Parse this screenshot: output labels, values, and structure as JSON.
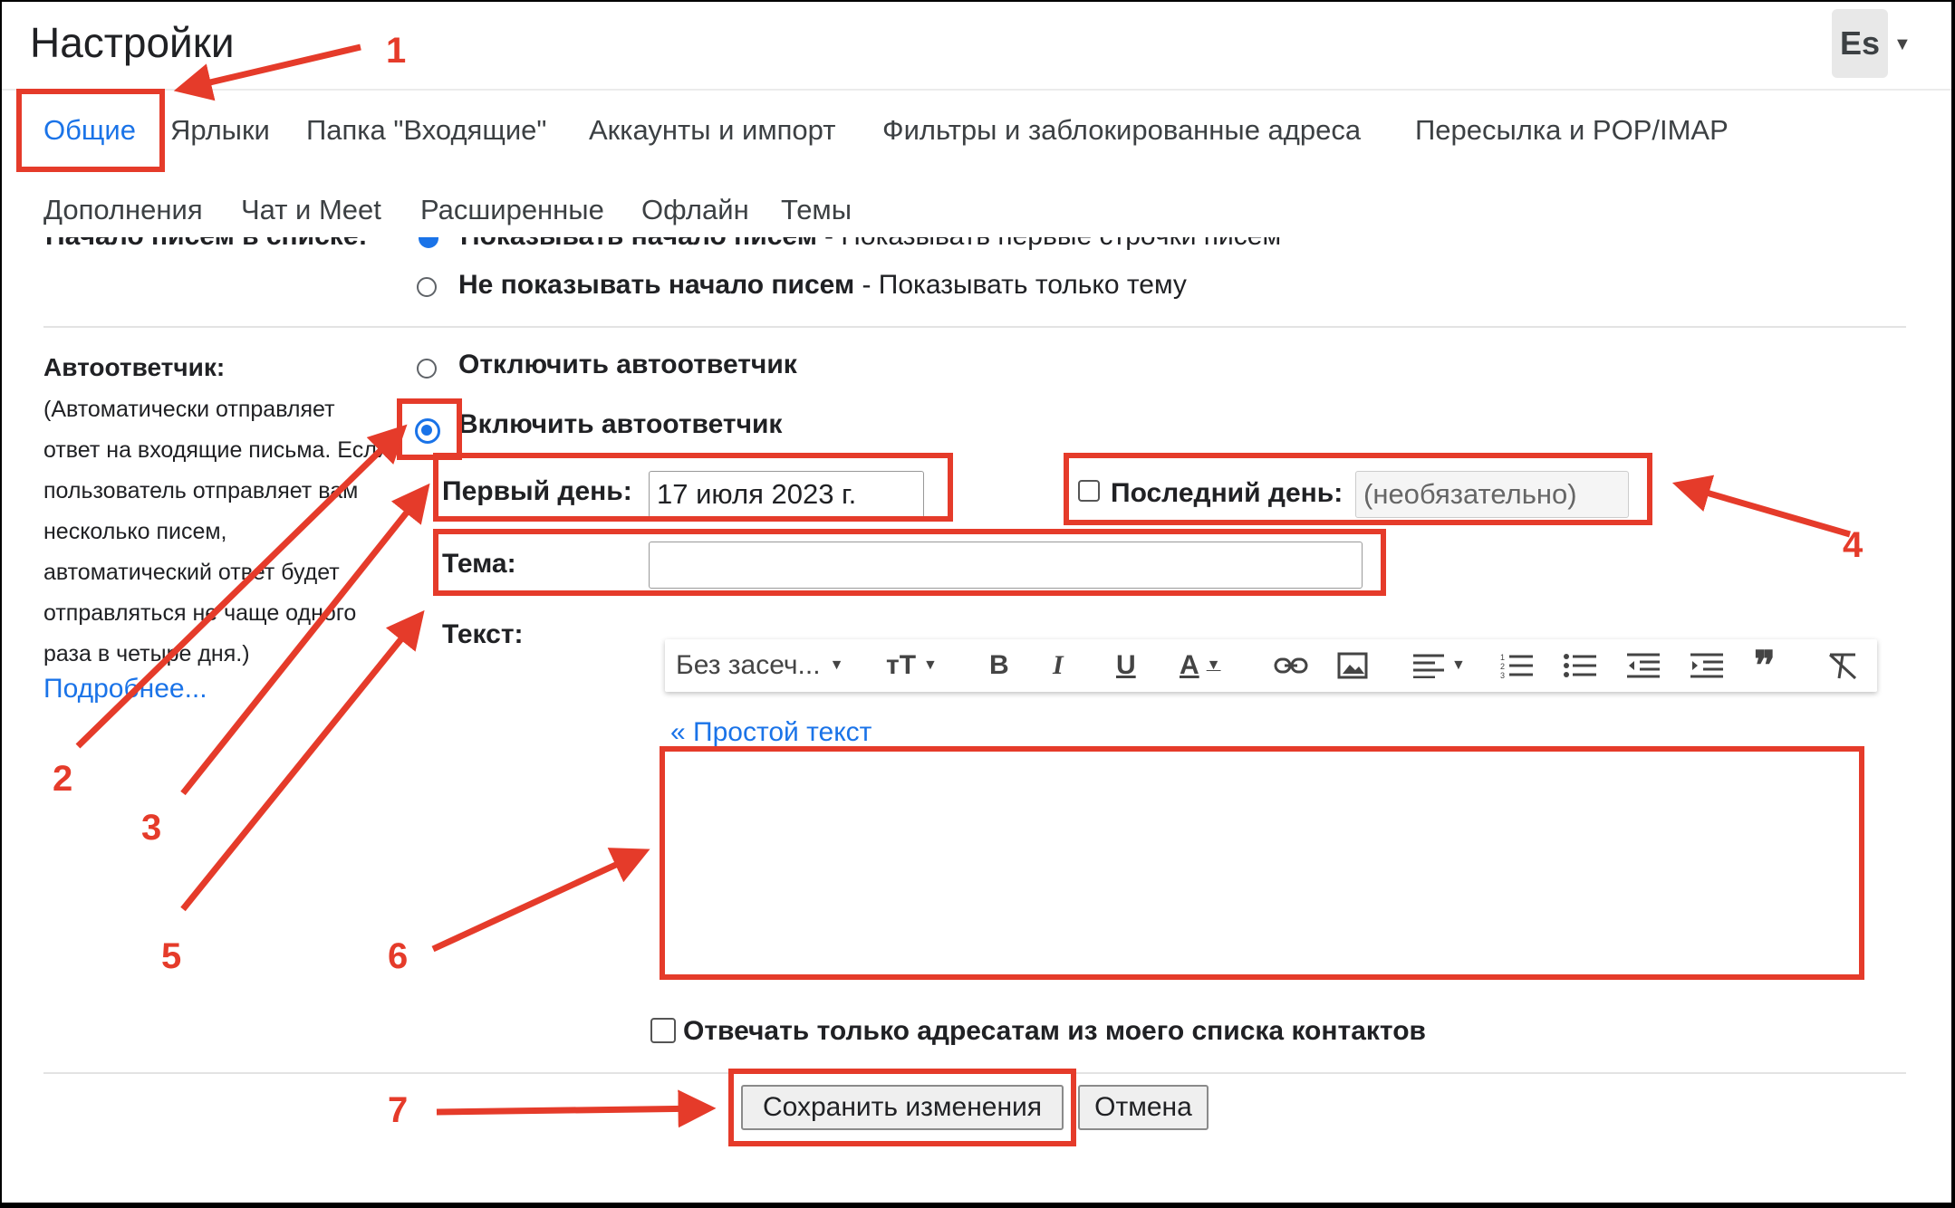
{
  "header": {
    "title": "Настройки",
    "account_initials": "Es"
  },
  "tabs_row1": [
    "Общие",
    "Ярлыки",
    "Папка \"Входящие\"",
    "Аккаунты и импорт",
    "Фильтры и заблокированные адреса",
    "Пересылка и POP/IMAP"
  ],
  "tabs_row2": [
    "Дополнения",
    "Чат и Meet",
    "Расширенные",
    "Офлайн",
    "Темы"
  ],
  "snippets": {
    "label": "Начало писем в списке:",
    "show_label": "Показывать начало писем",
    "show_desc": "- Показывать первые строчки писем",
    "hide_label": "Не показывать начало писем",
    "hide_desc": "- Показывать только тему"
  },
  "vacation": {
    "label": "Автоответчик:",
    "description_lines": [
      "(Автоматически отправляет",
      "ответ на входящие письма. Если",
      "пользователь отправляет вам",
      "несколько писем,",
      "автоматический ответ будет",
      "отправляться не чаще одного",
      "раза в четыре дня.)"
    ],
    "more_link": "Подробнее...",
    "off_label": "Отключить автоответчик",
    "on_label": "Включить автоответчик",
    "first_day_label": "Первый день:",
    "first_day_value": "17 июля 2023 г.",
    "last_day_label": "Последний день:",
    "last_day_placeholder": "(необязательно)",
    "subject_label": "Тема:",
    "subject_value": "",
    "text_label": "Текст:",
    "plain_text_link": "« Простой текст",
    "contacts_only_label": "Отвечать только адресатам из моего списка контактов"
  },
  "toolbar": {
    "font_family": "Без засеч...",
    "icons": [
      "font-size-icon",
      "bold-icon",
      "italic-icon",
      "underline-icon",
      "text-color-icon",
      "link-icon",
      "image-icon",
      "align-icon",
      "numbered-list-icon",
      "bulleted-list-icon",
      "indent-less-icon",
      "indent-more-icon",
      "quote-icon",
      "remove-formatting-icon"
    ]
  },
  "buttons": {
    "save": "Сохранить изменения",
    "cancel": "Отмена"
  },
  "annotations": [
    "1",
    "2",
    "3",
    "4",
    "5",
    "6",
    "7"
  ],
  "colors": {
    "accent": "#1a73e8",
    "annotation": "#e53b2a"
  }
}
